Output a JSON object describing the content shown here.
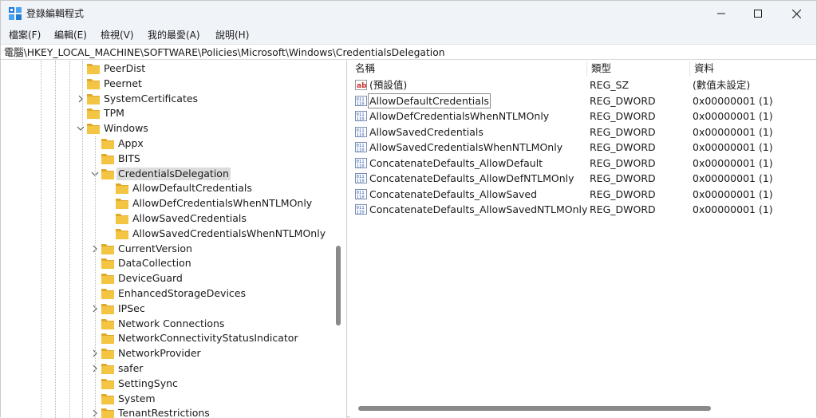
{
  "window": {
    "title": "登錄編輯程式"
  },
  "menu": [
    "檔案(F)",
    "編輯(E)",
    "檢視(V)",
    "我的最愛(A)",
    "說明(H)"
  ],
  "address": "電腦\\HKEY_LOCAL_MACHINE\\SOFTWARE\\Policies\\Microsoft\\Windows\\CredentialsDelegation",
  "tree": [
    {
      "label": "PeerDist",
      "expandable": false
    },
    {
      "label": "Peernet",
      "expandable": false
    },
    {
      "label": "SystemCertificates",
      "expandable": true,
      "expanded": false
    },
    {
      "label": "TPM",
      "expandable": false
    },
    {
      "label": "Windows",
      "expandable": true,
      "expanded": true
    },
    {
      "label": "Appx",
      "expandable": false
    },
    {
      "label": "BITS",
      "expandable": false
    },
    {
      "label": "CredentialsDelegation",
      "expandable": true,
      "expanded": true,
      "selected": true
    },
    {
      "label": "AllowDefaultCredentials",
      "expandable": false
    },
    {
      "label": "AllowDefCredentialsWhenNTLMOnly",
      "expandable": false
    },
    {
      "label": "AllowSavedCredentials",
      "expandable": false
    },
    {
      "label": "AllowSavedCredentialsWhenNTLMOnly",
      "expandable": false
    },
    {
      "label": "CurrentVersion",
      "expandable": true,
      "expanded": false
    },
    {
      "label": "DataCollection",
      "expandable": false
    },
    {
      "label": "DeviceGuard",
      "expandable": false
    },
    {
      "label": "EnhancedStorageDevices",
      "expandable": false
    },
    {
      "label": "IPSec",
      "expandable": true,
      "expanded": false
    },
    {
      "label": "Network Connections",
      "expandable": false
    },
    {
      "label": "NetworkConnectivityStatusIndicator",
      "expandable": false
    },
    {
      "label": "NetworkProvider",
      "expandable": true,
      "expanded": false
    },
    {
      "label": "safer",
      "expandable": true,
      "expanded": false
    },
    {
      "label": "SettingSync",
      "expandable": false
    },
    {
      "label": "System",
      "expandable": false
    },
    {
      "label": "TenantRestrictions",
      "expandable": true,
      "expanded": false
    }
  ],
  "columns": {
    "name": "名稱",
    "type": "類型",
    "data": "資料"
  },
  "values": [
    {
      "icon": "string-value-icon",
      "name": "(預設值)",
      "type": "REG_SZ",
      "data": "(數值未設定)"
    },
    {
      "icon": "binary-value-icon",
      "name": "AllowDefaultCredentials",
      "type": "REG_DWORD",
      "data": "0x00000001 (1)",
      "focused": true
    },
    {
      "icon": "binary-value-icon",
      "name": "AllowDefCredentialsWhenNTLMOnly",
      "type": "REG_DWORD",
      "data": "0x00000001 (1)"
    },
    {
      "icon": "binary-value-icon",
      "name": "AllowSavedCredentials",
      "type": "REG_DWORD",
      "data": "0x00000001 (1)"
    },
    {
      "icon": "binary-value-icon",
      "name": "AllowSavedCredentialsWhenNTLMOnly",
      "type": "REG_DWORD",
      "data": "0x00000001 (1)"
    },
    {
      "icon": "binary-value-icon",
      "name": "ConcatenateDefaults_AllowDefault",
      "type": "REG_DWORD",
      "data": "0x00000001 (1)"
    },
    {
      "icon": "binary-value-icon",
      "name": "ConcatenateDefaults_AllowDefNTLMOnly",
      "type": "REG_DWORD",
      "data": "0x00000001 (1)"
    },
    {
      "icon": "binary-value-icon",
      "name": "ConcatenateDefaults_AllowSaved",
      "type": "REG_DWORD",
      "data": "0x00000001 (1)"
    },
    {
      "icon": "binary-value-icon",
      "name": "ConcatenateDefaults_AllowSavedNTLMOnly",
      "type": "REG_DWORD",
      "data": "0x00000001 (1)"
    }
  ],
  "colors": {
    "folder": "#f4c542",
    "folder_dark": "#e0a92a",
    "selection": "#dcdcdc",
    "titlebar": "#f0f4f9"
  }
}
